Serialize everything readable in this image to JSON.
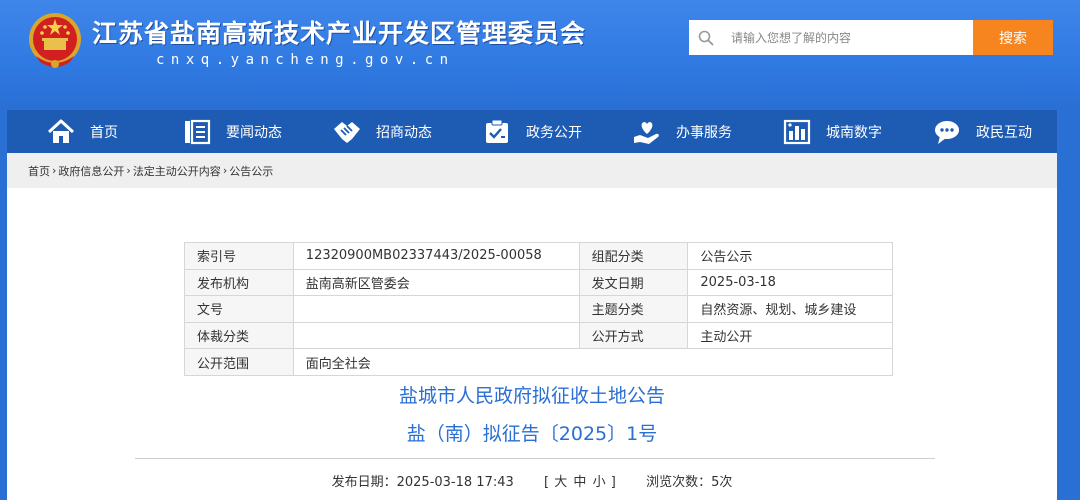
{
  "header": {
    "title": "江苏省盐南高新技术产业开发区管理委员会",
    "domain": "cnxq.yancheng.gov.cn",
    "emblem_icon": "national-emblem-icon"
  },
  "search": {
    "placeholder": "请输入您想了解的内容",
    "button_label": "搜索",
    "icon": "search-icon"
  },
  "nav": {
    "items": [
      {
        "label": "首页",
        "icon": "home-icon"
      },
      {
        "label": "要闻动态",
        "icon": "news-icon"
      },
      {
        "label": "招商动态",
        "icon": "handshake-icon"
      },
      {
        "label": "政务公开",
        "icon": "checklist-icon"
      },
      {
        "label": "办事服务",
        "icon": "service-hand-icon"
      },
      {
        "label": "城南数字",
        "icon": "city-data-icon"
      },
      {
        "label": "政民互动",
        "icon": "chat-icon"
      }
    ]
  },
  "breadcrumb": {
    "items": [
      "首页",
      "政府信息公开",
      "法定主动公开内容",
      "公告公示"
    ],
    "separator": "›"
  },
  "meta": {
    "rows": [
      {
        "l1": "索引号",
        "v1": "12320900MB02337443/2025-00058",
        "l2": "组配分类",
        "v2": "公告公示"
      },
      {
        "l1": "发布机构",
        "v1": "盐南高新区管委会",
        "l2": "发文日期",
        "v2": "2025-03-18"
      },
      {
        "l1": "文号",
        "v1": "",
        "l2": "主题分类",
        "v2": "自然资源、规划、城乡建设"
      },
      {
        "l1": "体裁分类",
        "v1": "",
        "l2": "公开方式",
        "v2": "主动公开"
      },
      {
        "l1": "公开范围",
        "v1": "面向全社会"
      }
    ]
  },
  "document": {
    "title": "盐城市人民政府拟征收土地公告",
    "subtitle": "盐（南）拟征告〔2025〕1号",
    "publish_label": "发布日期：",
    "publish_date": "2025-03-18 17:43",
    "font_size_open": "[",
    "font_large": "大",
    "font_medium": "中",
    "font_small": "小",
    "font_size_close": "]",
    "views_label": "浏览次数：",
    "views": "5次"
  },
  "colors": {
    "header_blue": "#2f79e2",
    "nav_blue": "#1e5bb3",
    "accent_orange": "#f7851f",
    "title_blue": "#2a6fd3"
  }
}
